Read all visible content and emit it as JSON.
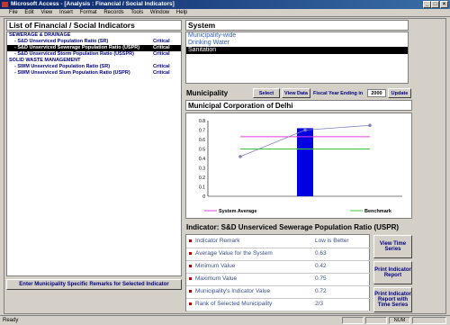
{
  "window": {
    "title": "Microsoft Access - [Analysis : Financial / Social Indicators]"
  },
  "menu": [
    "File",
    "Edit",
    "View",
    "Insert",
    "Format",
    "Records",
    "Tools",
    "Window",
    "Help"
  ],
  "indicators": {
    "title": "List of Financial / Social Indicators",
    "groups": [
      {
        "name": "SEWERAGE & DRAINAGE",
        "items": [
          {
            "label": "- S&D Unserviced Population Ratio (SR)",
            "flag": "Critical",
            "selected": false
          },
          {
            "label": "- S&D Unserviced Sewerage Population Ratio (USPR)",
            "flag": "Critical",
            "selected": true
          },
          {
            "label": "- S&D Unserviced Storm Population Ratio (USSPR)",
            "flag": "Critical",
            "selected": false
          }
        ]
      },
      {
        "name": "SOLID WASTE MANAGEMENT",
        "items": [
          {
            "label": "- SWM Unserviced Population Ratio (SR)",
            "flag": "Critical",
            "selected": false
          },
          {
            "label": "- SWM Unserviced Slum Population Ratio (USPR)",
            "flag": "Critical",
            "selected": false
          }
        ]
      }
    ],
    "remarks_button": "Enter Municipality Specific Remarks for Selected Indicator"
  },
  "system": {
    "title": "System",
    "items": [
      {
        "label": "Municipality-wide",
        "selected": false
      },
      {
        "label": "Drinking Water",
        "selected": false
      },
      {
        "label": "Sanitation",
        "selected": true
      }
    ]
  },
  "municipality": {
    "label": "Municipality Name:",
    "select_button": "Select",
    "view_data_button": "View Data",
    "fy_label": "Fiscal Year Ending in",
    "fy_value": "2000",
    "update_button": "Update",
    "name": "Municipal Corporation of Delhi"
  },
  "chart_data": {
    "type": "line",
    "y_ticks": [
      "0.8",
      "0.7",
      "0.6",
      "0.5",
      "0.4",
      "0.3",
      "0.2",
      "0.1",
      "0"
    ],
    "ylim": [
      0,
      0.8
    ],
    "x": [
      1,
      2,
      3
    ],
    "xlim": [
      0.5,
      3.5
    ],
    "series": [
      {
        "name": "System Average",
        "type": "line",
        "color": "#e040e0",
        "values": [
          0.63,
          0.63,
          0.63
        ]
      },
      {
        "name": "Benchmark",
        "type": "line",
        "color": "#33cc33",
        "values": [
          0.5,
          0.5,
          0.5
        ]
      },
      {
        "name": "",
        "type": "line-markers",
        "color": "#8080c0",
        "values": [
          0.42,
          0.7,
          0.75
        ]
      },
      {
        "name": "",
        "type": "bar",
        "color": "#0000e0",
        "x": 2,
        "value": 0.72
      }
    ],
    "legend_position": "bottom"
  },
  "details": {
    "title": "Indicator: S&D Unserviced Sewerage Population Ratio (USPR)",
    "rows": [
      {
        "label": "Indicator Remark",
        "value": "Low is Better"
      },
      {
        "label": "Average Value for the System",
        "value": "0.63"
      },
      {
        "label": "Minimum Value",
        "value": "0.42"
      },
      {
        "label": "Maximum Value",
        "value": "0.75"
      },
      {
        "label": "Municipality's Indicator Value",
        "value": "0.72"
      },
      {
        "label": "Rank of Selected Municipality",
        "value": "2/3"
      }
    ],
    "buttons": {
      "view_time_series": "View Time Series",
      "print_report": "Print Indicator Report",
      "print_report_ts": "Print Indicator Report with Time Series"
    }
  },
  "statusbar": {
    "text": "Ready",
    "mode": "NUM"
  }
}
